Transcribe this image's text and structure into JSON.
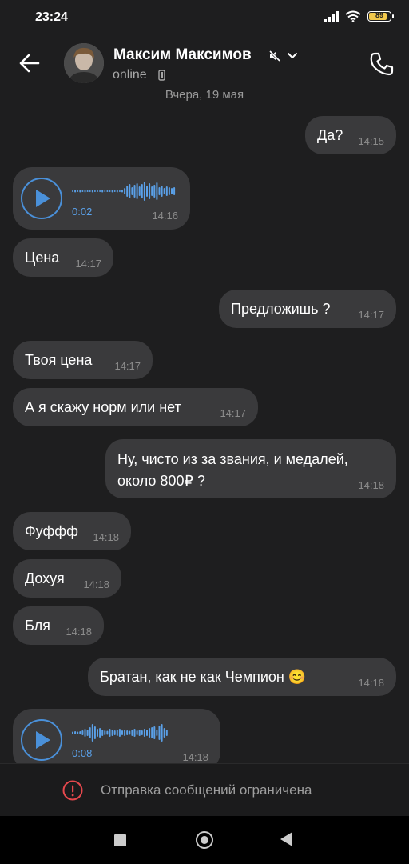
{
  "status_bar": {
    "time": "23:24",
    "battery": "89",
    "battery_fraction": 0.89
  },
  "header": {
    "contact_name": "Максим Максимов",
    "status": "online"
  },
  "chat": {
    "date_separator": "Вчера, 19 мая",
    "messages": [
      {
        "id": "m1",
        "direction": "out",
        "type": "text",
        "text": "Да?",
        "time": "14:15"
      },
      {
        "id": "m2",
        "direction": "in",
        "type": "voice",
        "duration": "0:02",
        "time": "14:16"
      },
      {
        "id": "m3",
        "direction": "in",
        "type": "text",
        "text": "Цена",
        "time": "14:17"
      },
      {
        "id": "m4",
        "direction": "out",
        "type": "text",
        "text": "Предложишь ?",
        "time": "14:17"
      },
      {
        "id": "m5",
        "direction": "in",
        "type": "text",
        "text": "Твоя цена",
        "time": "14:17"
      },
      {
        "id": "m6",
        "direction": "in",
        "type": "text",
        "text": "А я скажу норм или нет",
        "time": "14:17"
      },
      {
        "id": "m7",
        "direction": "out",
        "type": "text",
        "text": "Ну, чисто из за звания, и медалей, около 800₽ ?",
        "time": "14:18"
      },
      {
        "id": "m8",
        "direction": "in",
        "type": "text",
        "text": "Фуффф",
        "time": "14:18"
      },
      {
        "id": "m9",
        "direction": "in",
        "type": "text",
        "text": "Дохуя",
        "time": "14:18"
      },
      {
        "id": "m10",
        "direction": "in",
        "type": "text",
        "text": "Бля",
        "time": "14:18"
      },
      {
        "id": "m11",
        "direction": "out",
        "type": "text",
        "text": "Братан, как не как Чемпион 😊",
        "time": "14:18"
      },
      {
        "id": "m12",
        "direction": "in",
        "type": "voice",
        "duration": "0:08",
        "time": "14:18"
      }
    ]
  },
  "restriction": {
    "text": "Отправка сообщений ограничена"
  },
  "colors": {
    "accent": "#4a90d9",
    "bubble": "#3a3a3c",
    "background": "#1e1e1f",
    "alert": "#e5484d"
  }
}
